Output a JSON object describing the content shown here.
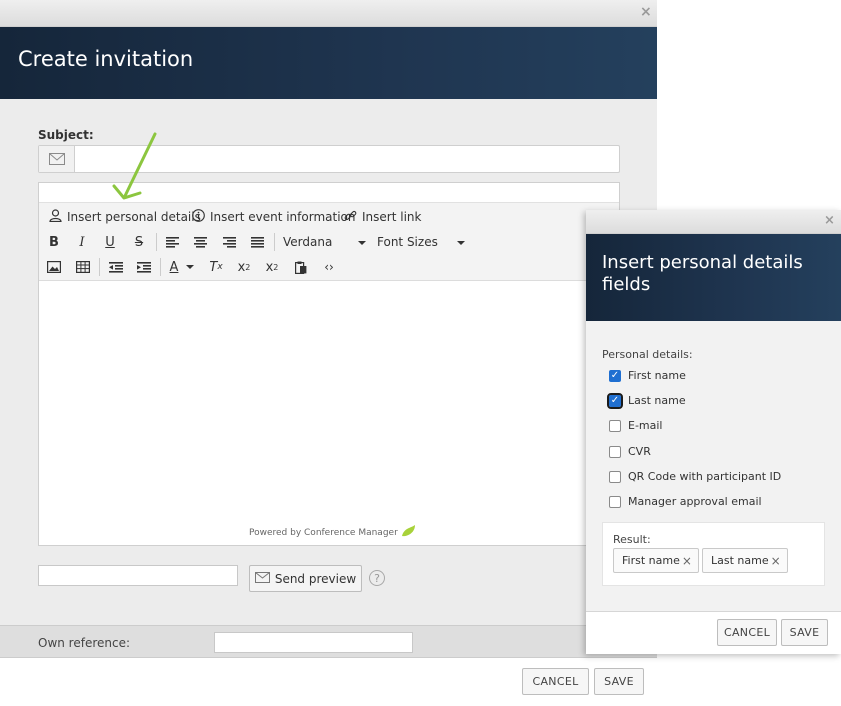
{
  "main_dialog": {
    "title": "Create invitation",
    "close_glyph": "×",
    "subject_label": "Subject:",
    "subject_value": "",
    "toolbar": {
      "insert_personal_details": "Insert personal details",
      "insert_event_information": "Insert event information",
      "insert_link": "Insert link",
      "font_family": "Verdana",
      "font_sizes": "Font Sizes"
    },
    "powered_by": "Powered by Conference Manager",
    "preview_email_value": "",
    "send_preview_label": "Send preview",
    "help_glyph": "?",
    "own_reference_label": "Own reference:",
    "own_reference_value": "",
    "cancel_label": "CANCEL",
    "save_label": "SAVE"
  },
  "side_panel": {
    "title": "Insert personal details fields",
    "close_glyph": "×",
    "section_label": "Personal details:",
    "fields": [
      {
        "label": "First name",
        "checked": true
      },
      {
        "label": "Last name",
        "checked": true,
        "focused": true
      },
      {
        "label": "E-mail",
        "checked": false
      },
      {
        "label": "CVR",
        "checked": false
      },
      {
        "label": "QR Code with participant ID",
        "checked": false
      },
      {
        "label": "Manager approval email",
        "checked": false
      }
    ],
    "result_label": "Result:",
    "result_tags": [
      "First name",
      "Last name"
    ],
    "tag_remove_glyph": "×",
    "cancel_label": "CANCEL",
    "save_label": "SAVE"
  },
  "colors": {
    "header_navy": "#1f3550",
    "checkbox_blue": "#1f6fd1",
    "arrow_green": "#8cc63f",
    "powered_leaf": "#a8d23a"
  }
}
